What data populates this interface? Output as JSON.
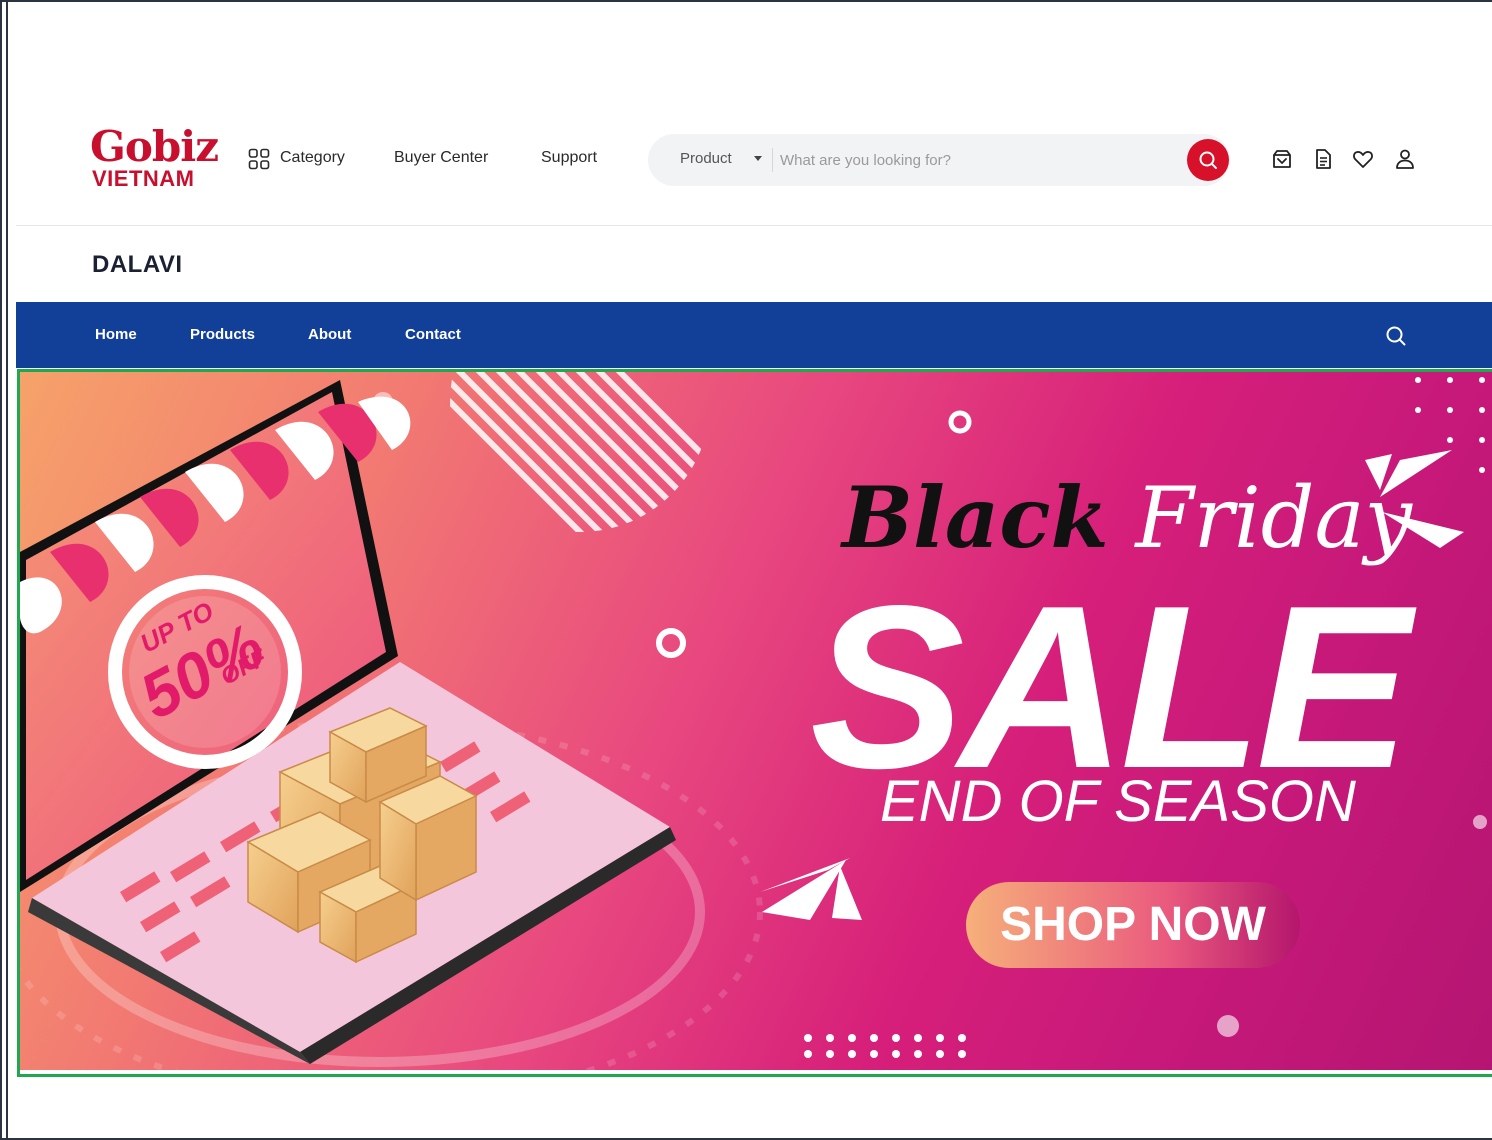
{
  "header": {
    "logo_main": "Gobiz",
    "logo_sub": "VIETNAM",
    "nav": [
      {
        "label": "Category",
        "icon": "grid-icon"
      },
      {
        "label": "Buyer Center"
      },
      {
        "label": "Support"
      }
    ],
    "search": {
      "category": "Product",
      "placeholder": "What are you looking for?",
      "button_icon": "search-icon"
    },
    "icons": [
      "download-box-icon",
      "document-icon",
      "heart-icon",
      "user-icon"
    ]
  },
  "shop": {
    "name": "DALAVI",
    "nav": [
      "Home",
      "Products",
      "About",
      "Contact"
    ],
    "bar_color": "#123f97"
  },
  "banner": {
    "script_black": "Black",
    "script_white": "Friday",
    "headline": "SALE",
    "subline": "END OF SEASON",
    "cta": "SHOP NOW",
    "badge_top": "UP TO",
    "badge_value": "50%",
    "badge_off": "OFF",
    "accent": "#d61f7a"
  }
}
